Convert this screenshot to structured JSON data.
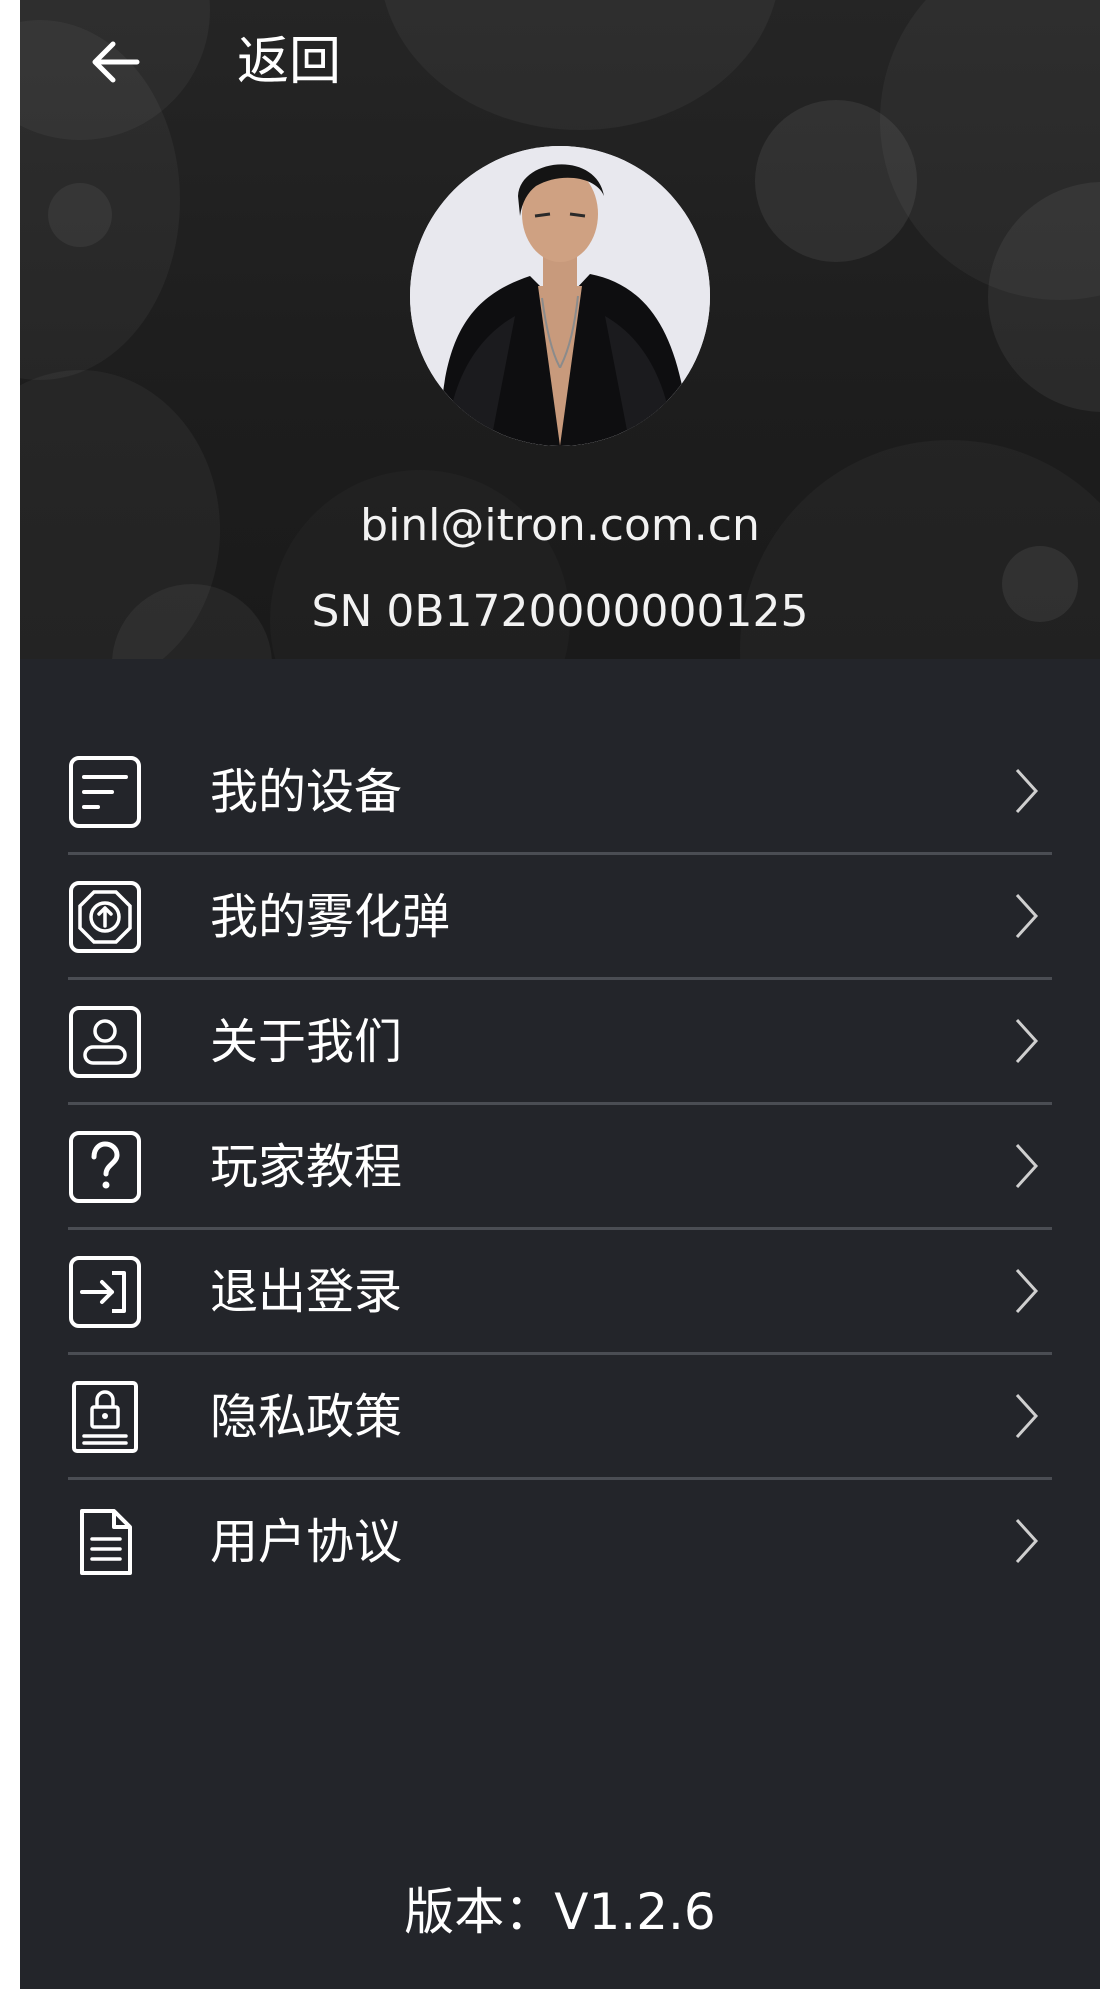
{
  "header": {
    "back_label": "返回",
    "email": "binl@itron.com.cn",
    "serial": "SN 0B1720000000125"
  },
  "menu": {
    "items": [
      {
        "label": "我的设备",
        "icon": "device-icon"
      },
      {
        "label": "我的雾化弹",
        "icon": "atomizer-icon"
      },
      {
        "label": "关于我们",
        "icon": "about-user-icon"
      },
      {
        "label": "玩家教程",
        "icon": "question-icon"
      },
      {
        "label": "退出登录",
        "icon": "logout-icon"
      },
      {
        "label": "隐私政策",
        "icon": "privacy-lock-icon"
      },
      {
        "label": "用户协议",
        "icon": "document-icon"
      }
    ]
  },
  "footer": {
    "version": "版本：V1.2.6"
  },
  "colors": {
    "background": "#23252a",
    "header": "#1f1f1f",
    "divider": "#4a4d53",
    "text": "#ffffff"
  }
}
